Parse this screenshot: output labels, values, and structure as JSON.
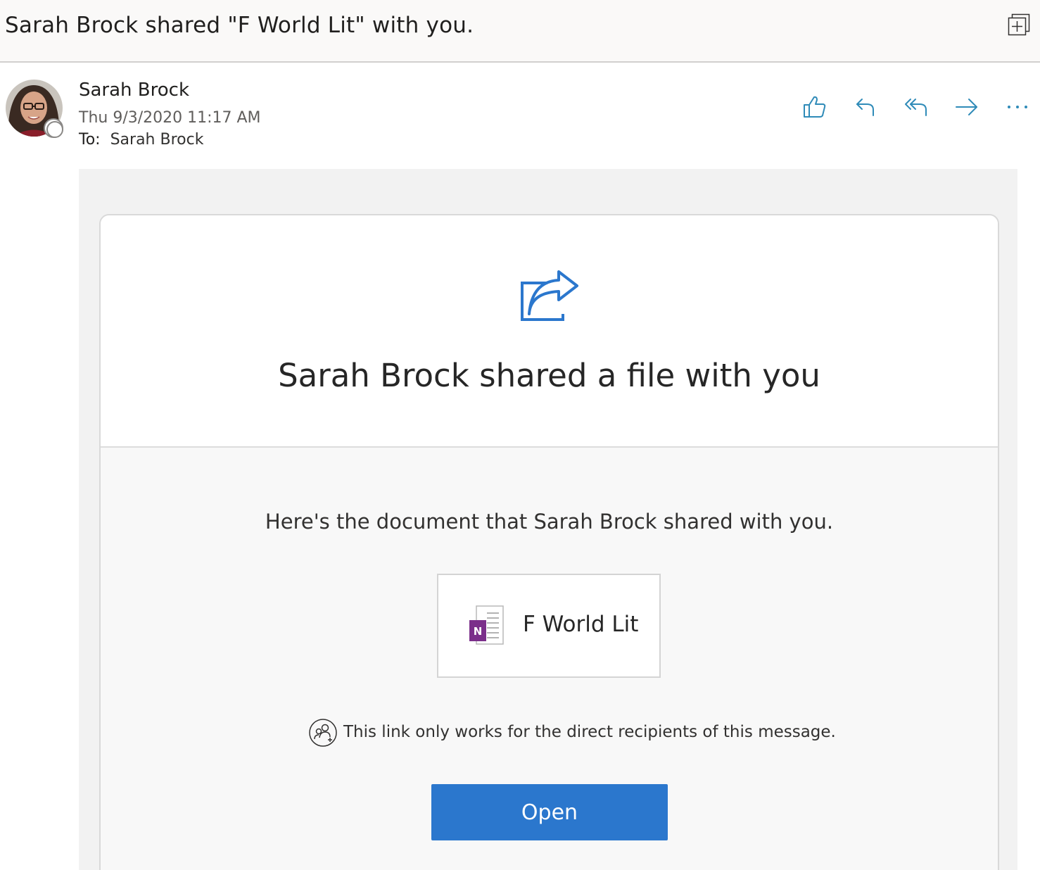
{
  "subject": "Sarah Brock shared \"F World Lit\" with you.",
  "icons": {
    "popout": "open-in-new-window-icon",
    "like": "thumbs-up-icon",
    "reply": "reply-icon",
    "reply_all": "reply-all-icon",
    "forward": "forward-icon",
    "more": "more-actions-icon",
    "share": "share-icon",
    "file": "onenote-icon",
    "notice": "people-icon"
  },
  "message": {
    "sender_name": "Sarah Brock",
    "datetime": "Thu 9/3/2020 11:17 AM",
    "to_label": "To:",
    "to_value": "Sarah Brock"
  },
  "card": {
    "title": "Sarah Brock shared a file with you",
    "intro": "Here's the document that Sarah Brock shared with you.",
    "file_name": "F World Lit",
    "file_icon_letter": "N",
    "notice": "This link only works for the direct recipients of this message.",
    "open_label": "Open"
  },
  "colors": {
    "accent": "#2b77cd",
    "action_icon": "#2f8bb8",
    "onenote": "#7b2f8a"
  }
}
